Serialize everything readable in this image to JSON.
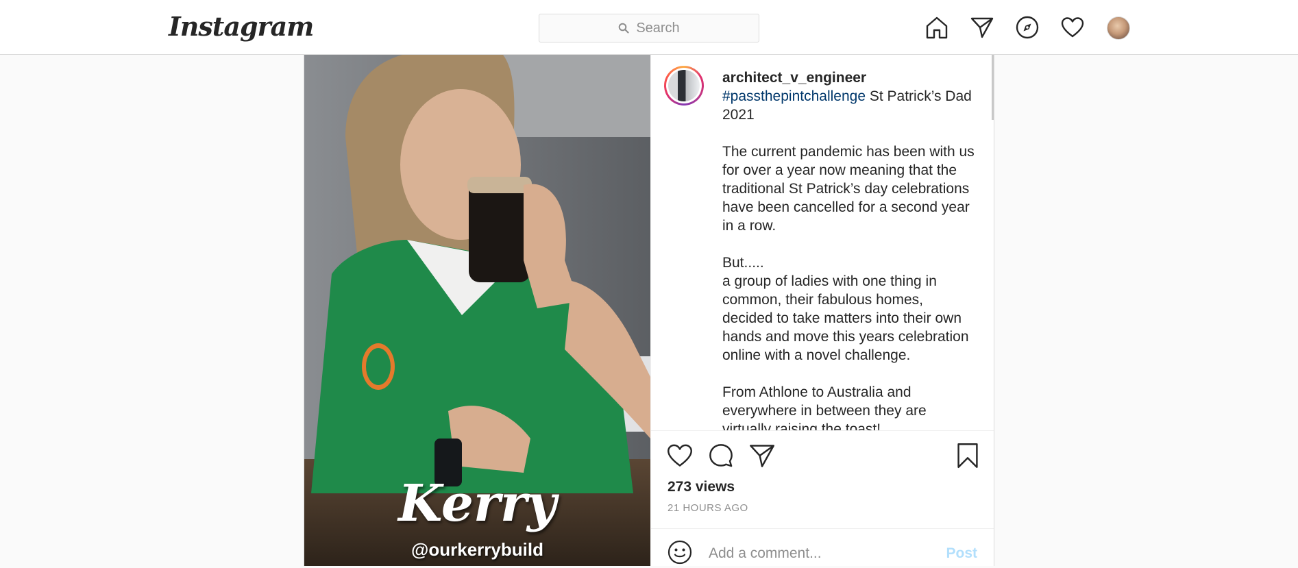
{
  "header": {
    "logo": "Instagram",
    "search_placeholder": "Search",
    "icons": [
      "home-icon",
      "direct-icon",
      "explore-icon",
      "activity-icon",
      "profile-avatar"
    ]
  },
  "post": {
    "video_overlay": {
      "name": "Kerry",
      "handle": "@ourkerrybuild"
    },
    "author": "architect_v_engineer",
    "caption": {
      "hashtag": "#passthepintchallenge",
      "title_rest": " St Patrick’s Dad 2021",
      "paragraph1": "The current pandemic has been with us for over a year now meaning that the traditional St Patrick’s day celebrations have been cancelled for a second year in a row.",
      "but": "But.....",
      "paragraph2": "a group of ladies with one thing in common, their fabulous homes, decided to take matters into their own hands and move this years celebration online with a novel challenge.",
      "paragraph3": "From Athlone to Australia and everywhere in between they are virtually raising the toast!"
    },
    "views": "273 views",
    "time_ago": "21 HOURS AGO",
    "comment_placeholder": "Add a comment...",
    "post_button": "Post"
  },
  "colors": {
    "hashtag": "#00376b",
    "post_button_disabled": "#b2dffc",
    "muted_text": "#8e8e8e",
    "border": "#dbdbdb"
  }
}
